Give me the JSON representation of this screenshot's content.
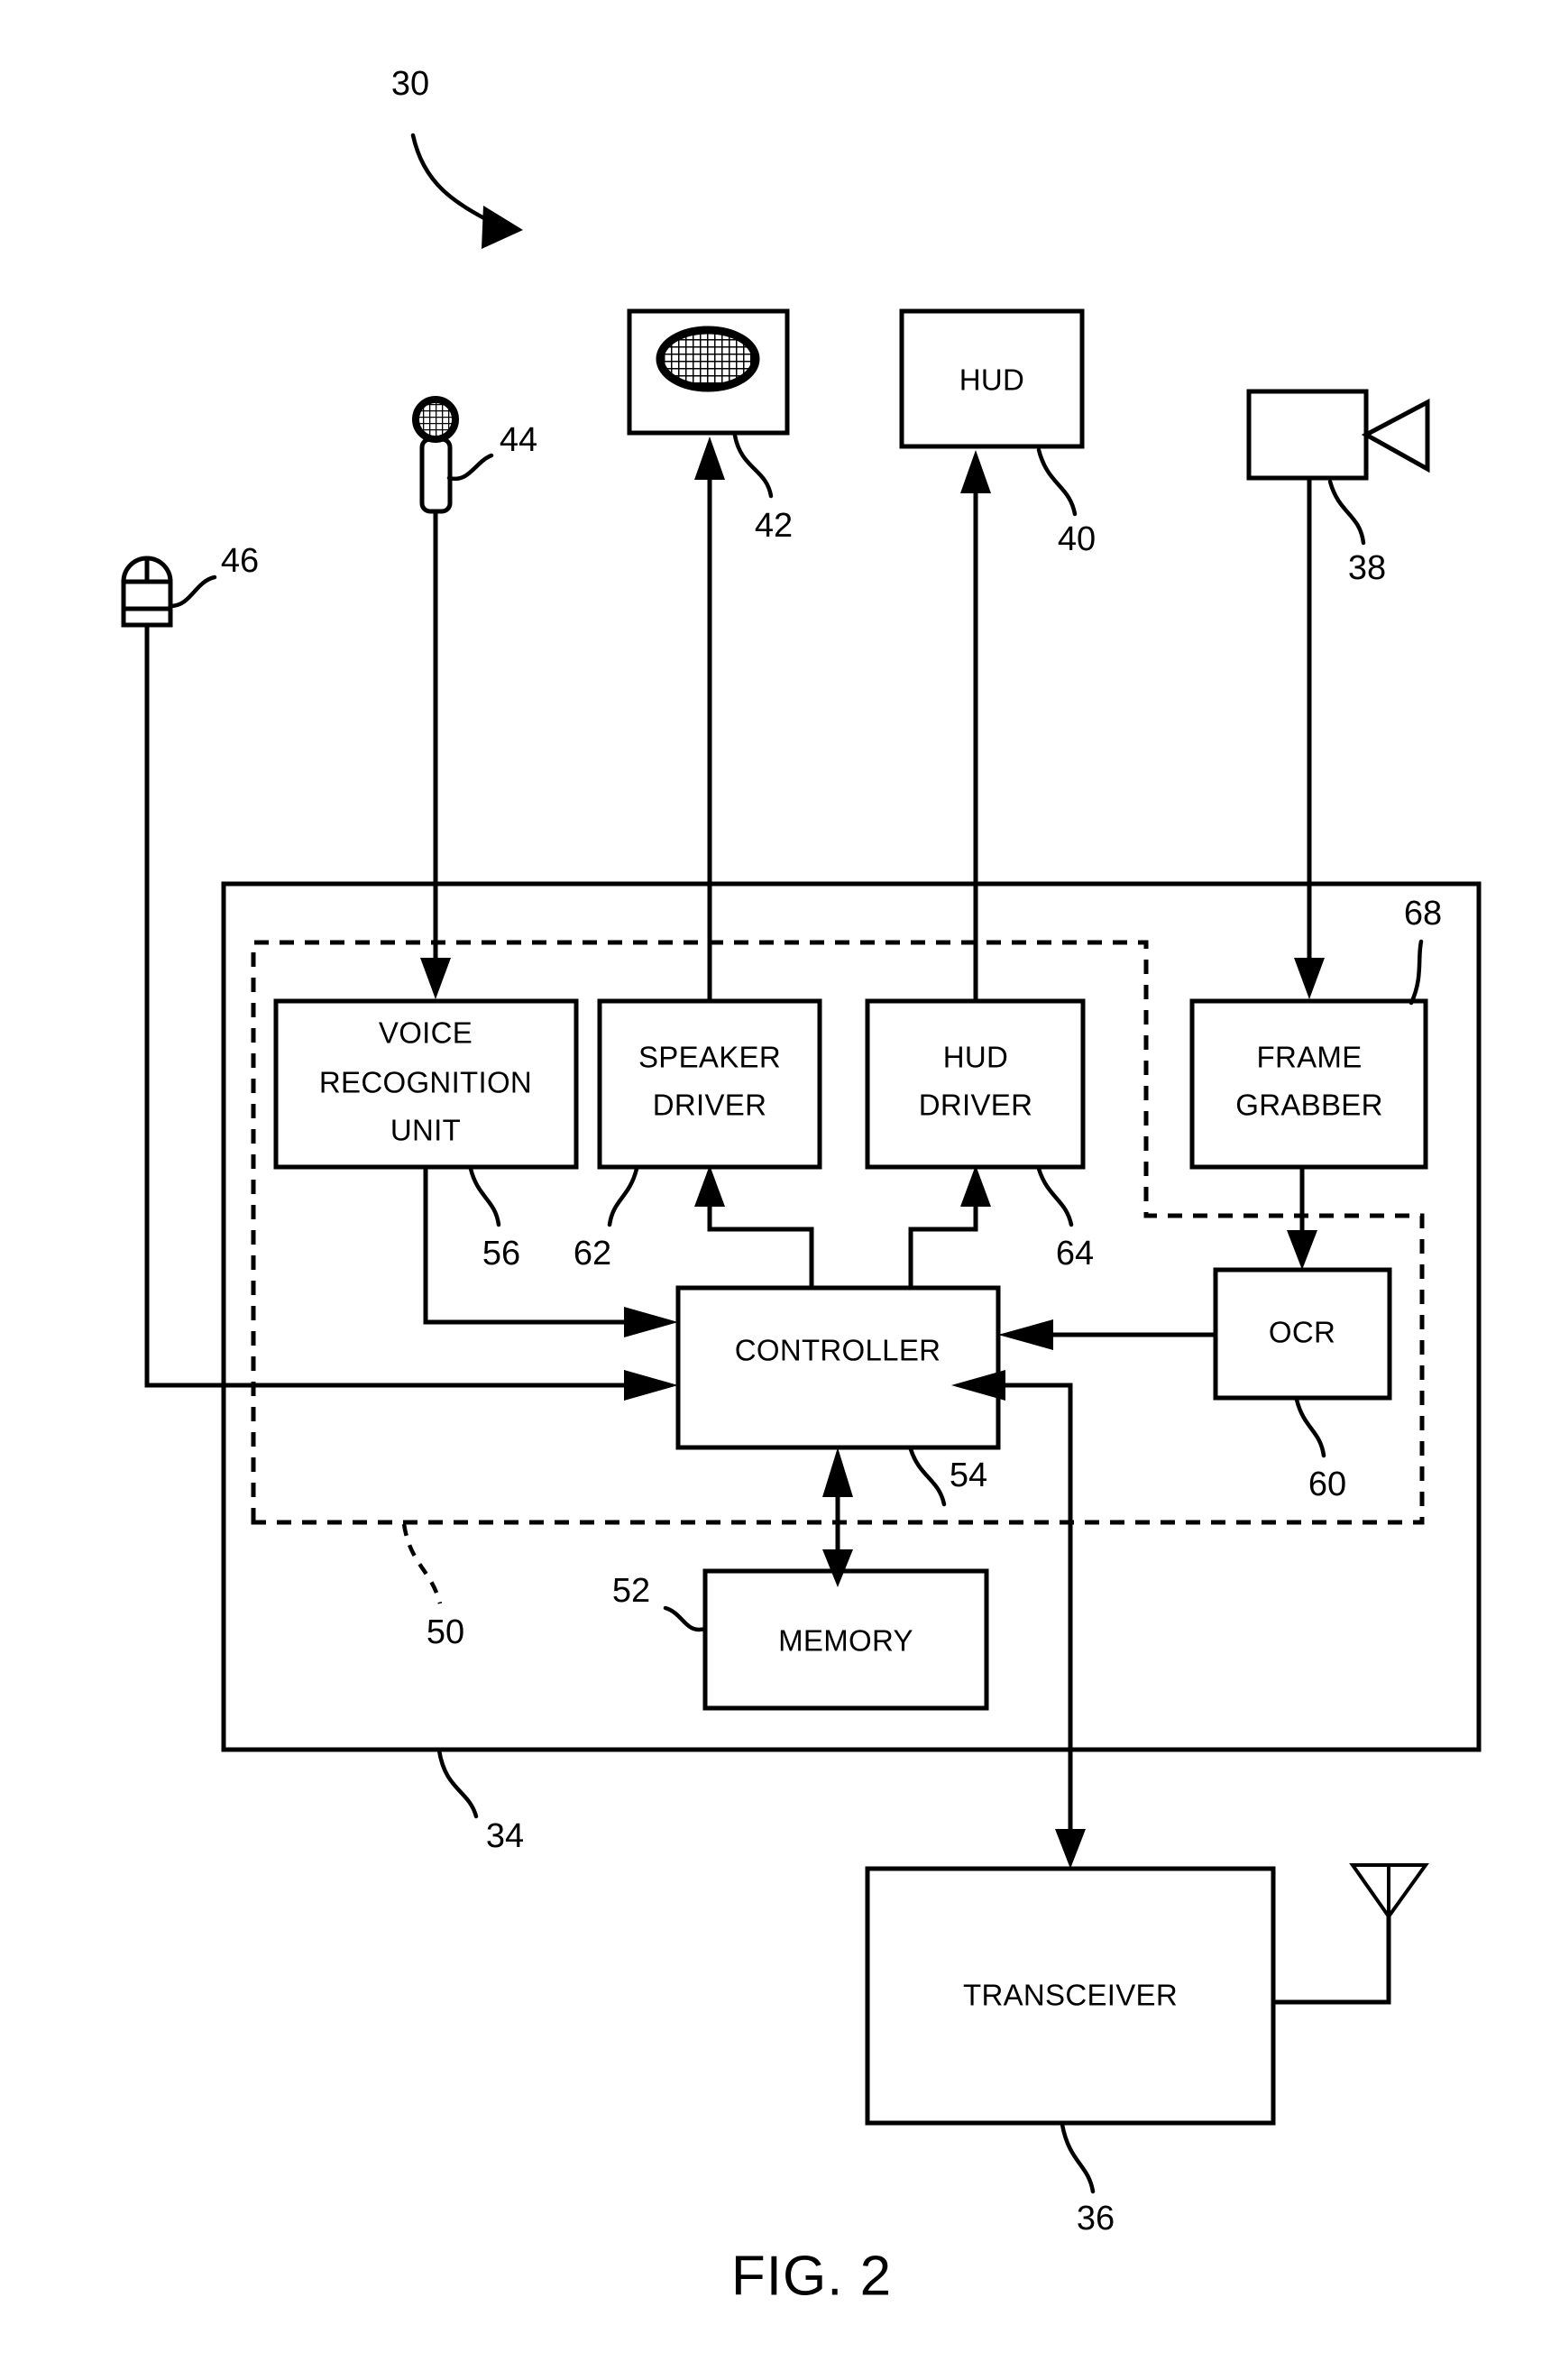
{
  "figure": {
    "caption": "FIG. 2",
    "system_ref": "30"
  },
  "blocks": {
    "hud": {
      "label": "HUD",
      "ref": "40"
    },
    "speaker": {
      "label": "",
      "ref": "42",
      "icon": "speaker-icon"
    },
    "camera": {
      "label": "",
      "ref": "38",
      "icon": "camera-icon"
    },
    "microphone": {
      "label": "",
      "ref": "44",
      "icon": "microphone-icon"
    },
    "mouse": {
      "label": "",
      "ref": "46",
      "icon": "mouse-icon"
    },
    "voice_recognition_unit": {
      "line1": "VOICE",
      "line2": "RECOGNITION",
      "line3": "UNIT",
      "ref": "56"
    },
    "speaker_driver": {
      "line1": "SPEAKER",
      "line2": "DRIVER",
      "ref": "62"
    },
    "hud_driver": {
      "line1": "HUD",
      "line2": "DRIVER",
      "ref": "64"
    },
    "frame_grabber": {
      "line1": "FRAME",
      "line2": "GRABBER",
      "ref": "68"
    },
    "ocr": {
      "label": "OCR",
      "ref": "60"
    },
    "controller": {
      "label": "CONTROLLER",
      "ref": "54"
    },
    "memory": {
      "label": "MEMORY",
      "ref": "52"
    },
    "transceiver": {
      "label": "TRANSCEIVER",
      "ref": "36"
    },
    "enclosure": {
      "ref": "34"
    },
    "processor_boundary": {
      "ref": "50"
    }
  },
  "colors": {
    "line": "#000000",
    "background": "#ffffff"
  }
}
